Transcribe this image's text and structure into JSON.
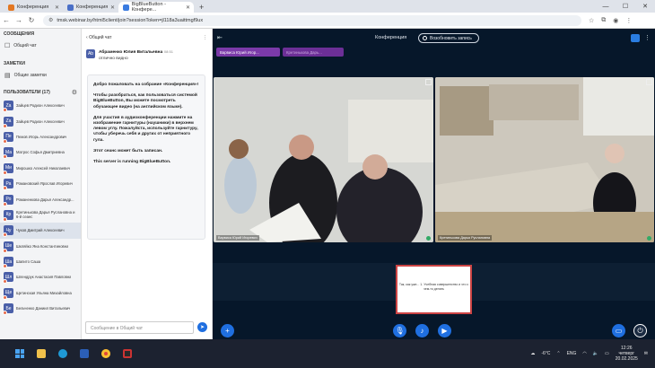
{
  "browser": {
    "tabs": [
      {
        "title": "Конференция",
        "color": "#e37722"
      },
      {
        "title": "Конференция",
        "color": "#4a6fc7"
      },
      {
        "title": "BigBlueButton - Конфере...",
        "color": "#3a7be0",
        "active": true
      }
    ],
    "url": "tmsk.webinar.by/html5client/join?sessionToken=jl118a3uaittmgf9ux",
    "new_tab": "+"
  },
  "sidebar": {
    "messages_header": "СООБЩЕНИЯ",
    "public_chat": "Общий чат",
    "notes_header": "ЗАМЕТКИ",
    "shared_notes": "Общие заметки",
    "users_header": "ПОЛЬЗОВАТЕЛИ (17)",
    "users": [
      {
        "initials": "Za",
        "name": "Зайцев Родион Алексеевич"
      },
      {
        "initials": "Za",
        "name": "Зайцев Родион Алексеевич"
      },
      {
        "initials": "Пе",
        "name": "Пежов Игорь Александрович"
      },
      {
        "initials": "Ма",
        "name": "Матрос Софья Дмитриевна"
      },
      {
        "initials": "Ми",
        "name": "Мирошко Алексей Николаевич"
      },
      {
        "initials": "Ра",
        "name": "Романовский Ярослав Игоревич"
      },
      {
        "initials": "Ро",
        "name": "Романенкова Дарья Александр..."
      },
      {
        "initials": "Кр",
        "name": "Кретинькова Дарья Руслановна и 6-й сеанс"
      },
      {
        "initials": "Чу",
        "name": "Чуков Дмитрий Алексеевич"
      },
      {
        "initials": "Ше",
        "name": "Шкляйко Яна Константиновна"
      },
      {
        "initials": "Ша",
        "name": "Шапито Саша"
      },
      {
        "initials": "Шл",
        "name": "Шлендрук Анастасия Павловна"
      },
      {
        "initials": "Ще",
        "name": "Щетинская Ульяна Михайловна"
      },
      {
        "initials": "Бе",
        "name": "Бельченко Даниил Витальевич"
      }
    ]
  },
  "chat": {
    "title": "Общий чат",
    "message": {
      "initials": "Ab",
      "author": "Абраменко Юлия Витальевна",
      "time": "08:51",
      "text": "отлично видно"
    },
    "welcome": {
      "greeting": "Добро пожаловать на собрание «Конференция»!",
      "p2": "Чтобы разобраться, как пользоваться системой BigBlueButton, Вы можете посмотреть обучающее видео (на английском языке).",
      "p3": "Для участия в аудиоконференции нажмите на изображение гарнитуры (наушники) в верхнем левом углу. Пожалуйста, используйте гарнитуру, чтобы уберечь себя и других от неприятного гула.",
      "p4": "Этот сеанс может быть записан.",
      "p5": "This server is running BigBlueButton."
    },
    "input_placeholder": "Сообщение в Общий чат"
  },
  "meeting": {
    "title": "Конференция",
    "record_label": "Возобновить запись",
    "talkers": [
      "Варвиса Юрий Игор...",
      "Кретинькова Дарь..."
    ],
    "videos": [
      {
        "label": "Варвиса Юрий Игоревич"
      },
      {
        "label": "Кретинькова Дарья Руслановна"
      }
    ],
    "slide_text": "Так, как уже... 1. Учебная совершенство и что с чем-то делать"
  },
  "taskbar": {
    "weather": "-6°C",
    "lang": "ENG",
    "time": "12:26",
    "day": "четверг",
    "date": "20.02.2025"
  }
}
